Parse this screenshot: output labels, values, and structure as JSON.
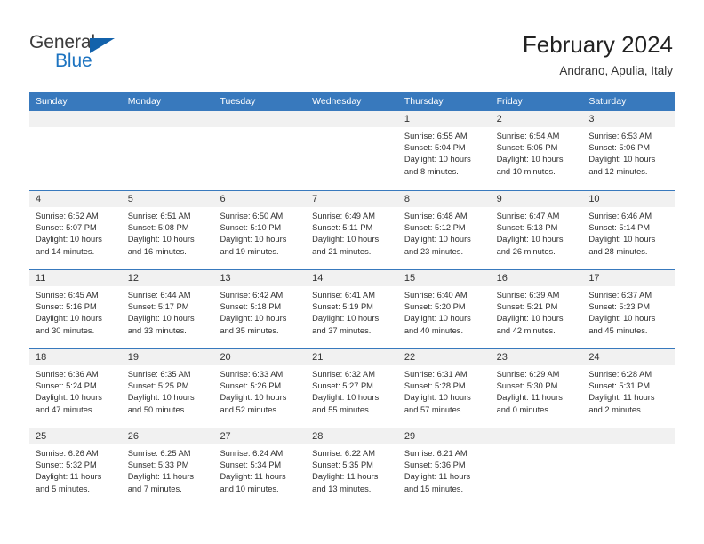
{
  "brand": {
    "name_part1": "General",
    "name_part2": "Blue",
    "colors": {
      "dark": "#3b3b3b",
      "blue": "#1c73c0",
      "triangle": "#1362ab"
    }
  },
  "header": {
    "title": "February 2024",
    "subtitle": "Andrano, Apulia, Italy"
  },
  "theme": {
    "header_bg": "#3879bd",
    "header_text": "#ffffff",
    "daynum_bg": "#f1f1f1",
    "cell_bg": "#ffffff",
    "body_text": "#2f2f2f"
  },
  "calendar": {
    "weekdays": [
      "Sunday",
      "Monday",
      "Tuesday",
      "Wednesday",
      "Thursday",
      "Friday",
      "Saturday"
    ],
    "weeks": [
      [
        {
          "day": "",
          "lines": []
        },
        {
          "day": "",
          "lines": []
        },
        {
          "day": "",
          "lines": []
        },
        {
          "day": "",
          "lines": []
        },
        {
          "day": "1",
          "lines": [
            "Sunrise: 6:55 AM",
            "Sunset: 5:04 PM",
            "Daylight: 10 hours",
            "and 8 minutes."
          ]
        },
        {
          "day": "2",
          "lines": [
            "Sunrise: 6:54 AM",
            "Sunset: 5:05 PM",
            "Daylight: 10 hours",
            "and 10 minutes."
          ]
        },
        {
          "day": "3",
          "lines": [
            "Sunrise: 6:53 AM",
            "Sunset: 5:06 PM",
            "Daylight: 10 hours",
            "and 12 minutes."
          ]
        }
      ],
      [
        {
          "day": "4",
          "lines": [
            "Sunrise: 6:52 AM",
            "Sunset: 5:07 PM",
            "Daylight: 10 hours",
            "and 14 minutes."
          ]
        },
        {
          "day": "5",
          "lines": [
            "Sunrise: 6:51 AM",
            "Sunset: 5:08 PM",
            "Daylight: 10 hours",
            "and 16 minutes."
          ]
        },
        {
          "day": "6",
          "lines": [
            "Sunrise: 6:50 AM",
            "Sunset: 5:10 PM",
            "Daylight: 10 hours",
            "and 19 minutes."
          ]
        },
        {
          "day": "7",
          "lines": [
            "Sunrise: 6:49 AM",
            "Sunset: 5:11 PM",
            "Daylight: 10 hours",
            "and 21 minutes."
          ]
        },
        {
          "day": "8",
          "lines": [
            "Sunrise: 6:48 AM",
            "Sunset: 5:12 PM",
            "Daylight: 10 hours",
            "and 23 minutes."
          ]
        },
        {
          "day": "9",
          "lines": [
            "Sunrise: 6:47 AM",
            "Sunset: 5:13 PM",
            "Daylight: 10 hours",
            "and 26 minutes."
          ]
        },
        {
          "day": "10",
          "lines": [
            "Sunrise: 6:46 AM",
            "Sunset: 5:14 PM",
            "Daylight: 10 hours",
            "and 28 minutes."
          ]
        }
      ],
      [
        {
          "day": "11",
          "lines": [
            "Sunrise: 6:45 AM",
            "Sunset: 5:16 PM",
            "Daylight: 10 hours",
            "and 30 minutes."
          ]
        },
        {
          "day": "12",
          "lines": [
            "Sunrise: 6:44 AM",
            "Sunset: 5:17 PM",
            "Daylight: 10 hours",
            "and 33 minutes."
          ]
        },
        {
          "day": "13",
          "lines": [
            "Sunrise: 6:42 AM",
            "Sunset: 5:18 PM",
            "Daylight: 10 hours",
            "and 35 minutes."
          ]
        },
        {
          "day": "14",
          "lines": [
            "Sunrise: 6:41 AM",
            "Sunset: 5:19 PM",
            "Daylight: 10 hours",
            "and 37 minutes."
          ]
        },
        {
          "day": "15",
          "lines": [
            "Sunrise: 6:40 AM",
            "Sunset: 5:20 PM",
            "Daylight: 10 hours",
            "and 40 minutes."
          ]
        },
        {
          "day": "16",
          "lines": [
            "Sunrise: 6:39 AM",
            "Sunset: 5:21 PM",
            "Daylight: 10 hours",
            "and 42 minutes."
          ]
        },
        {
          "day": "17",
          "lines": [
            "Sunrise: 6:37 AM",
            "Sunset: 5:23 PM",
            "Daylight: 10 hours",
            "and 45 minutes."
          ]
        }
      ],
      [
        {
          "day": "18",
          "lines": [
            "Sunrise: 6:36 AM",
            "Sunset: 5:24 PM",
            "Daylight: 10 hours",
            "and 47 minutes."
          ]
        },
        {
          "day": "19",
          "lines": [
            "Sunrise: 6:35 AM",
            "Sunset: 5:25 PM",
            "Daylight: 10 hours",
            "and 50 minutes."
          ]
        },
        {
          "day": "20",
          "lines": [
            "Sunrise: 6:33 AM",
            "Sunset: 5:26 PM",
            "Daylight: 10 hours",
            "and 52 minutes."
          ]
        },
        {
          "day": "21",
          "lines": [
            "Sunrise: 6:32 AM",
            "Sunset: 5:27 PM",
            "Daylight: 10 hours",
            "and 55 minutes."
          ]
        },
        {
          "day": "22",
          "lines": [
            "Sunrise: 6:31 AM",
            "Sunset: 5:28 PM",
            "Daylight: 10 hours",
            "and 57 minutes."
          ]
        },
        {
          "day": "23",
          "lines": [
            "Sunrise: 6:29 AM",
            "Sunset: 5:30 PM",
            "Daylight: 11 hours",
            "and 0 minutes."
          ]
        },
        {
          "day": "24",
          "lines": [
            "Sunrise: 6:28 AM",
            "Sunset: 5:31 PM",
            "Daylight: 11 hours",
            "and 2 minutes."
          ]
        }
      ],
      [
        {
          "day": "25",
          "lines": [
            "Sunrise: 6:26 AM",
            "Sunset: 5:32 PM",
            "Daylight: 11 hours",
            "and 5 minutes."
          ]
        },
        {
          "day": "26",
          "lines": [
            "Sunrise: 6:25 AM",
            "Sunset: 5:33 PM",
            "Daylight: 11 hours",
            "and 7 minutes."
          ]
        },
        {
          "day": "27",
          "lines": [
            "Sunrise: 6:24 AM",
            "Sunset: 5:34 PM",
            "Daylight: 11 hours",
            "and 10 minutes."
          ]
        },
        {
          "day": "28",
          "lines": [
            "Sunrise: 6:22 AM",
            "Sunset: 5:35 PM",
            "Daylight: 11 hours",
            "and 13 minutes."
          ]
        },
        {
          "day": "29",
          "lines": [
            "Sunrise: 6:21 AM",
            "Sunset: 5:36 PM",
            "Daylight: 11 hours",
            "and 15 minutes."
          ]
        },
        {
          "day": "",
          "lines": []
        },
        {
          "day": "",
          "lines": []
        }
      ]
    ]
  }
}
